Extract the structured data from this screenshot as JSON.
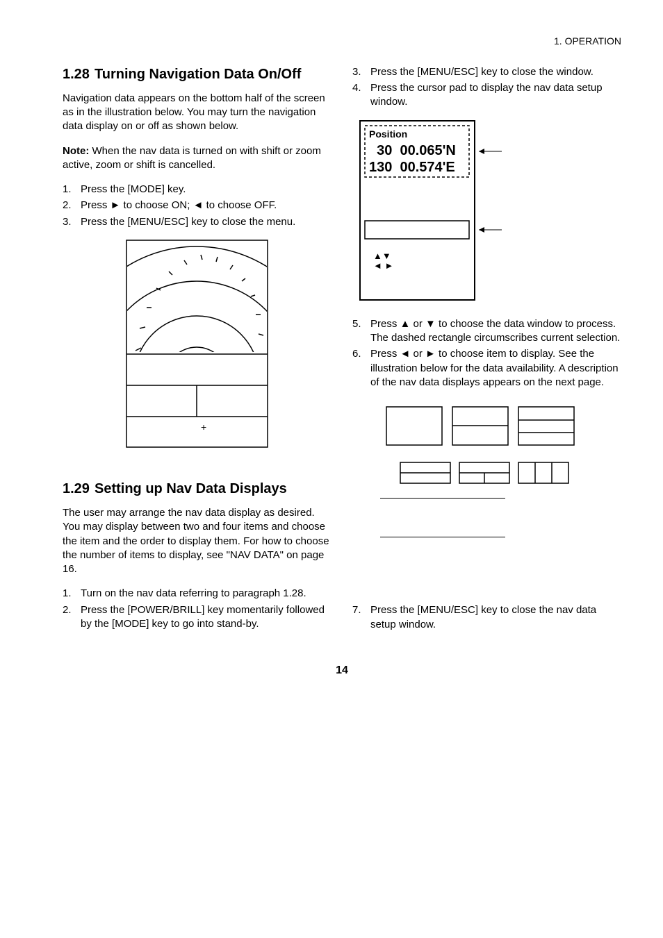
{
  "header": {
    "chapter": "1. OPERATION"
  },
  "left": {
    "sec128": {
      "number": "1.28",
      "title": "Turning Navigation Data On/Off",
      "intro": "Navigation data appears on the bottom half of the screen as in the illustration below. You may turn the navigation data display on or off as shown below.",
      "note_label": "Note:",
      "note_text": " When the nav data is turned on with shift or zoom active, zoom or shift is cancelled.",
      "steps": [
        {
          "n": "1.",
          "t": "Press the [MODE] key."
        },
        {
          "n": "2.",
          "t": "Press ► to choose ON; ◄ to choose OFF."
        },
        {
          "n": "3.",
          "t": "Press the [MENU/ESC] key to close the menu."
        }
      ]
    },
    "sec129": {
      "number": "1.29",
      "title": "Setting up Nav Data Displays",
      "intro": "The user may arrange the nav data display as desired. You may display between two and four items and choose the item and the order to display them. For how to choose the number of items to display, see \"NAV DATA\" on page 16.",
      "steps": [
        {
          "n": "1.",
          "t": "Turn on the nav data referring to paragraph 1.28."
        },
        {
          "n": "2.",
          "t": "Press the [POWER/BRILL] key momentarily followed by the [MODE] key to go into stand-by."
        }
      ]
    }
  },
  "right": {
    "steps_top": [
      {
        "n": "3.",
        "t": "Press the [MENU/ESC] key to close the window."
      },
      {
        "n": "4.",
        "t": "Press the cursor pad to display the nav data setup window."
      }
    ],
    "setup_window": {
      "title": "Position",
      "line1": "  30  00.065'N",
      "line2": "130  00.574'E",
      "arrows": "▲▼\n◄ ►"
    },
    "steps_mid": [
      {
        "n": "5.",
        "t": "Press ▲ or ▼ to choose the data window to process. The dashed rectangle circumscribes current selection."
      },
      {
        "n": "6.",
        "t": "Press ◄ or ► to choose item to display. See the illustration below for the data availability. A description of the nav data displays appears on the next page."
      }
    ],
    "steps_bottom": [
      {
        "n": "7.",
        "t": "Press the [MENU/ESC] key to close the nav data setup window."
      }
    ]
  },
  "page": "14"
}
